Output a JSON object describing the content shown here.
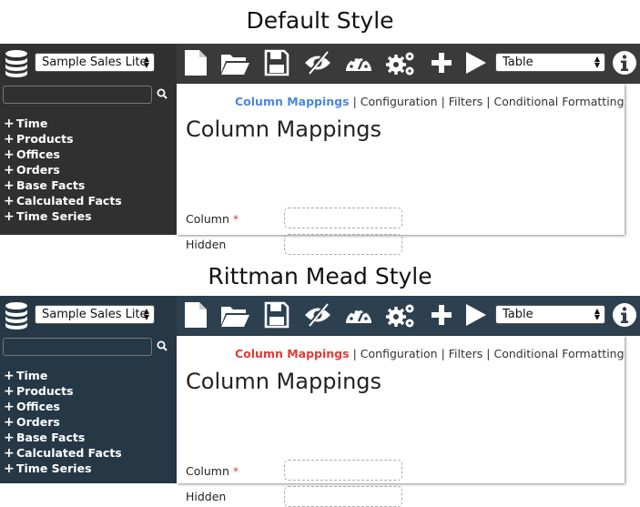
{
  "panels": [
    {
      "title": "Default Style",
      "colors": {
        "sidebar": "#303030",
        "toolbar": "#3a3a3a",
        "active_link": "#4a86e8"
      },
      "subject_area": "Sample Sales Lite",
      "tree": [
        "Time",
        "Products",
        "Offices",
        "Orders",
        "Base Facts",
        "Calculated Facts",
        "Time Series"
      ],
      "toolbar_icons": [
        "new-document-icon",
        "open-folder-icon",
        "save-icon",
        "hide-eye-icon",
        "dashboard-gauge-icon",
        "settings-gears-icon",
        "add-plus-icon",
        "run-play-icon",
        "info-icon"
      ],
      "visualisation": "Table",
      "nav_links": [
        "Column Mappings",
        "Configuration",
        "Filters",
        "Conditional Formatting"
      ],
      "nav_separator": "|",
      "heading": "Column Mappings",
      "fields": [
        {
          "label": "Column",
          "required_mark": "*"
        },
        {
          "label": "Hidden"
        }
      ]
    },
    {
      "title": "Rittman Mead Style",
      "colors": {
        "sidebar": "#263846",
        "toolbar": "#2d4050",
        "active_link": "#e53935"
      },
      "subject_area": "Sample Sales Lite",
      "tree": [
        "Time",
        "Products",
        "Offices",
        "Orders",
        "Base Facts",
        "Calculated Facts",
        "Time Series"
      ],
      "toolbar_icons": [
        "new-document-icon",
        "open-folder-icon",
        "save-icon",
        "hide-eye-icon",
        "dashboard-gauge-icon",
        "settings-gears-icon",
        "add-plus-icon",
        "run-play-icon",
        "info-icon"
      ],
      "visualisation": "Table",
      "nav_links": [
        "Column Mappings",
        "Configuration",
        "Filters",
        "Conditional Formatting"
      ],
      "nav_separator": "|",
      "heading": "Column Mappings",
      "fields": [
        {
          "label": "Column",
          "required_mark": "*"
        },
        {
          "label": "Hidden"
        }
      ]
    }
  ]
}
